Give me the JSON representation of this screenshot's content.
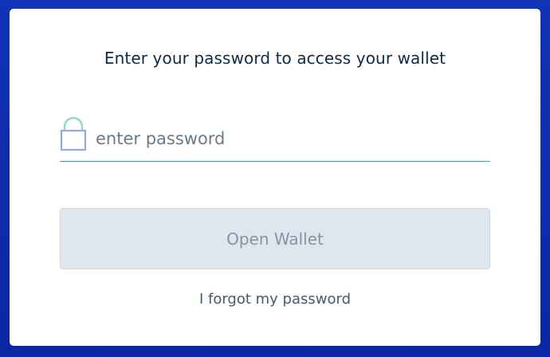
{
  "card": {
    "prompt": "Enter your password to access your wallet"
  },
  "password_field": {
    "placeholder": "enter password",
    "value": "",
    "icon": "lock-icon"
  },
  "open_button": {
    "label": "Open Wallet",
    "enabled": false
  },
  "forgot_link": {
    "label": "I forgot my password"
  },
  "colors": {
    "background": "#0d2aa8",
    "card": "#ffffff",
    "field_underline": "#23b68b",
    "lock_shackle": "#8fd9c6",
    "lock_body": "#9aa6e0",
    "button_disabled_bg": "#dfe6ed",
    "button_disabled_text": "#8296a8"
  }
}
